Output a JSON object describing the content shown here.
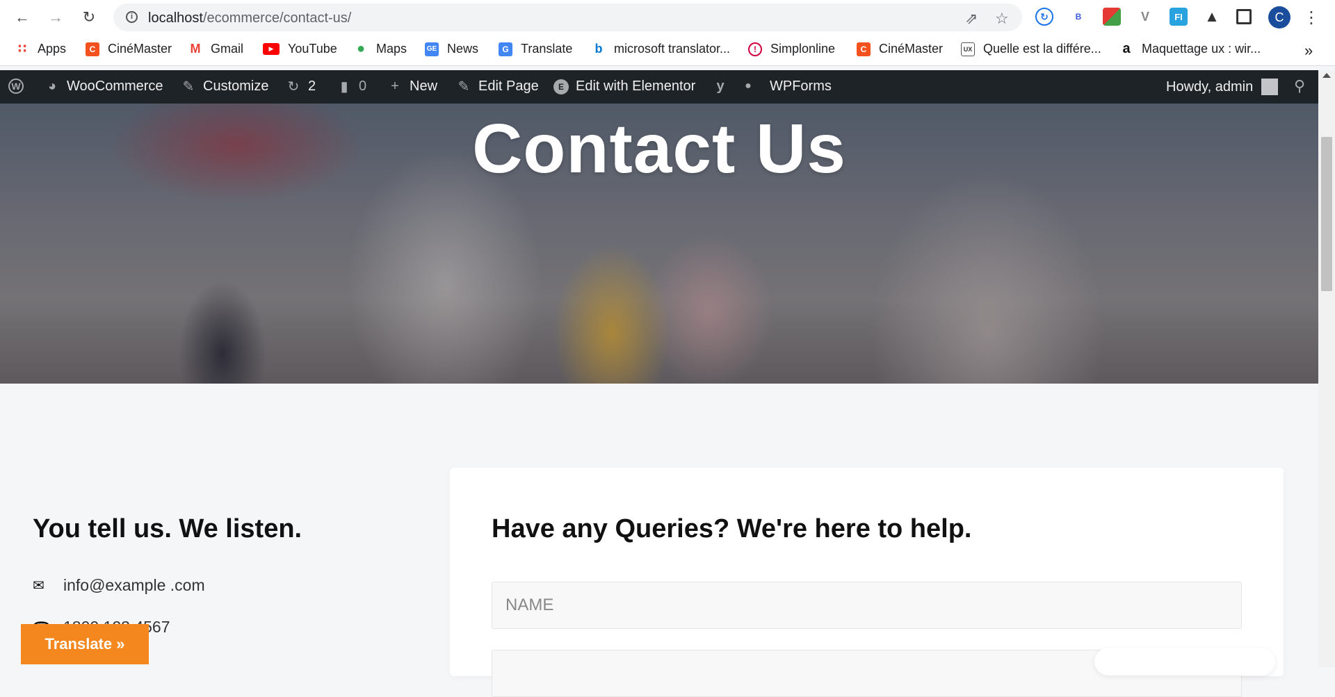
{
  "browser": {
    "url_host": "localhost",
    "url_path": "/ecommerce/contact-us/",
    "profile_initial": "C",
    "extensions": [
      "sync-icon",
      "b-extension",
      "puzzle-color-extension",
      "v-extension",
      "fi-extension",
      "extensions-puzzle-icon",
      "side-panel-icon"
    ],
    "bookmarks": [
      {
        "label": "Apps",
        "icon": "apps-grid-icon",
        "color": "#ea4335"
      },
      {
        "label": "CinéMaster",
        "icon": "cinemaster-icon",
        "color": "#f4511e"
      },
      {
        "label": "Gmail",
        "icon": "gmail-icon",
        "color": "#ea4335"
      },
      {
        "label": "YouTube",
        "icon": "youtube-icon",
        "color": "#ff0000"
      },
      {
        "label": "Maps",
        "icon": "maps-icon",
        "color": "#34a853"
      },
      {
        "label": "News",
        "icon": "news-icon",
        "color": "#4285f4"
      },
      {
        "label": "Translate",
        "icon": "translate-icon",
        "color": "#4285f4"
      },
      {
        "label": "microsoft translator...",
        "icon": "bing-icon",
        "color": "#0078d4"
      },
      {
        "label": "Simplonline",
        "icon": "simplonline-icon",
        "color": "#d1003f"
      },
      {
        "label": "CinéMaster",
        "icon": "cinemaster-icon",
        "color": "#f4511e"
      },
      {
        "label": "Quelle est la différe...",
        "icon": "blog-ux-icon",
        "color": "#555555"
      },
      {
        "label": "Maquettage ux : wir...",
        "icon": "amazon-icon",
        "color": "#111111"
      }
    ]
  },
  "adminbar": {
    "woocommerce": "WooCommerce",
    "customize": "Customize",
    "updates_count": "2",
    "comments_count": "0",
    "new": "New",
    "edit_page": "Edit Page",
    "edit_elementor": "Edit with Elementor",
    "wpforms": "WPForms",
    "howdy": "Howdy, admin"
  },
  "hero": {
    "title": "Contact Us"
  },
  "contact": {
    "title": "You tell us. We listen.",
    "email": "info@example .com",
    "phone": "1800 123 4567"
  },
  "form": {
    "title": "Have any Queries? We're here to help.",
    "name_placeholder": "NAME"
  },
  "translate_button": "Translate »",
  "colors": {
    "adminbar": "#1d2327",
    "translate_accent": "#f4881f",
    "page_bg": "#f5f6f8"
  }
}
